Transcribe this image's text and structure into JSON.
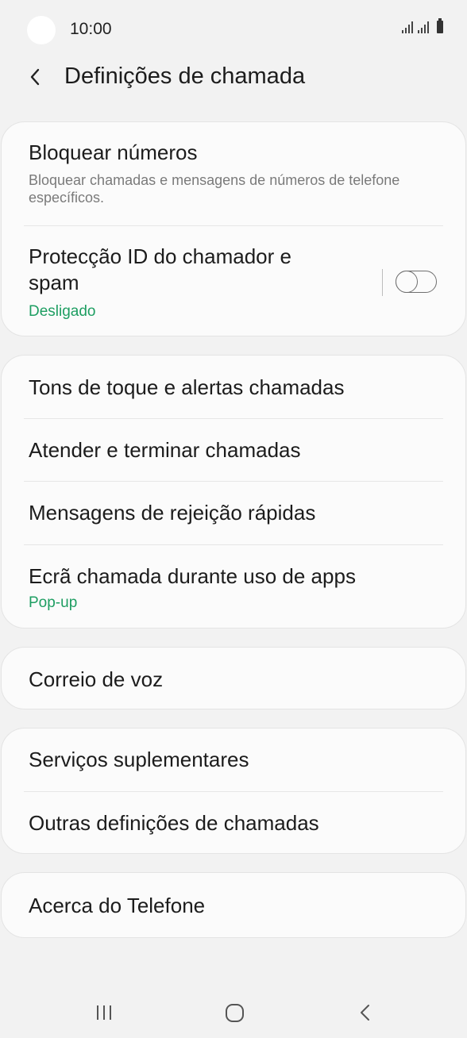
{
  "status_bar": {
    "time": "10:00",
    "icons": [
      "signal-icon",
      "signal-icon",
      "battery-icon"
    ]
  },
  "header": {
    "back_icon": "chevron-left-icon",
    "title": "Definições de chamada"
  },
  "groups": {
    "blocking": {
      "block_numbers": {
        "label": "Bloquear números",
        "description": "Bloquear chamadas e mensagens de números de telefone específicos."
      },
      "caller_id": {
        "label_line1": "Protecção ID do chamador e",
        "label_line2": "spam",
        "status": "Desligado",
        "toggle_on": false
      }
    },
    "call_settings": {
      "ringtones": {
        "label": "Tons de toque e alertas chamadas"
      },
      "answer_end": {
        "label": "Atender e terminar chamadas"
      },
      "quick_decline": {
        "label": "Mensagens de rejeição rápidas"
      },
      "call_display": {
        "label": "Ecrã chamada durante uso de apps",
        "value": "Pop-up"
      }
    },
    "voicemail": {
      "label": "Correio de voz"
    },
    "services": {
      "supplementary": {
        "label": "Serviços suplementares"
      },
      "other": {
        "label": "Outras definições de chamadas"
      }
    },
    "about": {
      "label": "Acerca do Telefone"
    }
  },
  "nav_bar": {
    "recents_icon": "recent-apps-icon",
    "home_icon": "home-icon",
    "back_icon": "back-icon"
  },
  "colors": {
    "background": "#f2f2f2",
    "card": "#fbfbfb",
    "accent_green": "#1e9e62",
    "secondary_text": "#7a7a7a"
  }
}
